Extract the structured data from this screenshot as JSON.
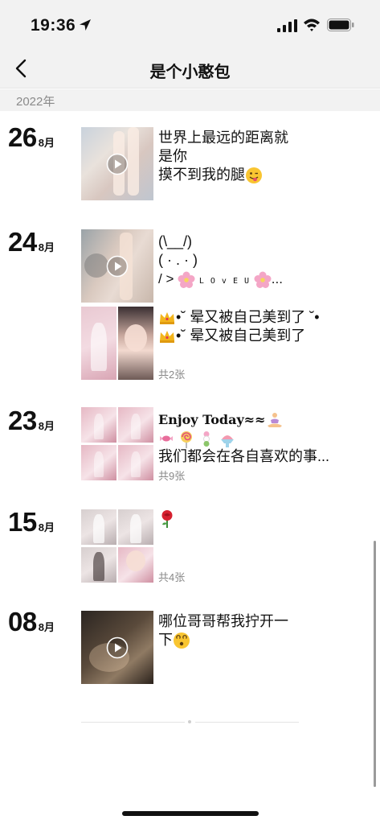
{
  "status": {
    "time": "19:36"
  },
  "nav": {
    "title": "是个小憨包"
  },
  "year": "2022年",
  "posts": [
    {
      "day": "26",
      "month": "8月",
      "lines": [
        "世界上最远的距离就",
        "是你",
        "摸不到我的腿"
      ],
      "emoji_end": "winking-tongue"
    },
    {
      "day": "24",
      "month": "8月",
      "lines": [
        "(\\__/)",
        "( · . · )",
        "/ >",
        "L O v E  U",
        "..."
      ]
    },
    {
      "lines": [
        "•˘ 晕又被自己美到了 ˘•",
        "•˘ 晕又被自己美到了"
      ],
      "count": "共2张"
    },
    {
      "day": "23",
      "month": "8月",
      "lines": [
        "Enjoy Today≈≈",
        "我们都会在各自喜欢的事..."
      ],
      "count": "共9张"
    },
    {
      "day": "15",
      "month": "8月",
      "count": "共4张"
    },
    {
      "day": "08",
      "month": "8月",
      "lines": [
        "哪位哥哥帮我拧开一",
        "下"
      ]
    }
  ]
}
